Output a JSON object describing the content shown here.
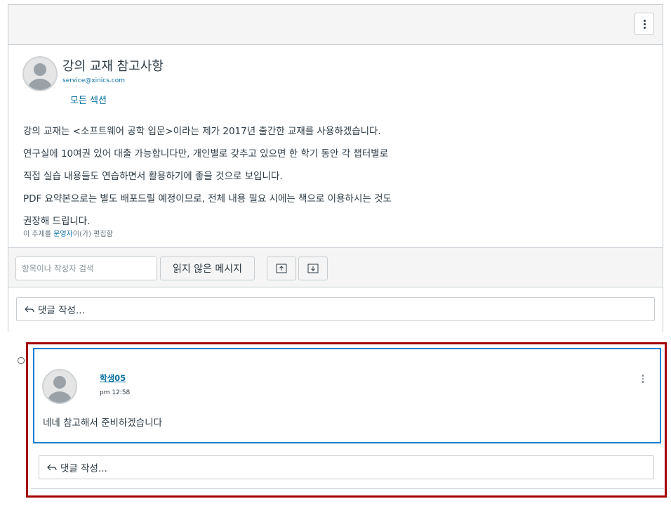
{
  "topic": {
    "title": "강의 교재 참고사항",
    "email": "service@xinics.com",
    "sections": "모든 섹션",
    "body_lines": [
      "강의 교재는 <소프트웨어 공학 입문>이라는 제가 2017년 출간한 교재를 사용하겠습니다.",
      "연구실에 10여권 있어 대출 가능합니다만, 개인별로 갖추고 있으면 한 학기 동안 각 챕터별로",
      "직접 실습 내용들도 연습하면서 활용하기에 좋을 것으로 보입니다.",
      "PDF 요약본으로는 별도 배포드릴 예정이므로, 전체 내용 필요 시에는 책으로 이용하시는 것도",
      "권장해 드립니다."
    ],
    "edited_prefix": "이 주제를 ",
    "edited_author": "운영자",
    "edited_suffix": "이(가) 편집함"
  },
  "toolbar": {
    "search_placeholder": "항목이나 작성자 검색",
    "unread_label": "읽지 않은 메시지"
  },
  "reply_prompt": "댓글 작성...",
  "reply": {
    "author": "학생05",
    "time": "pm 12:58",
    "message": "네네 참고해서 준비하겠습니다",
    "reply_prompt": "댓글 작성..."
  },
  "icons": {
    "more": "kebab-menu-icon",
    "collapse": "upload-arrow-icon",
    "expand": "download-arrow-icon",
    "reply": "reply-arrow-icon",
    "avatar": "default-avatar-icon"
  },
  "colors": {
    "link": "#0770a3",
    "highlight": "#a50000",
    "focus": "#1b7dd1"
  }
}
